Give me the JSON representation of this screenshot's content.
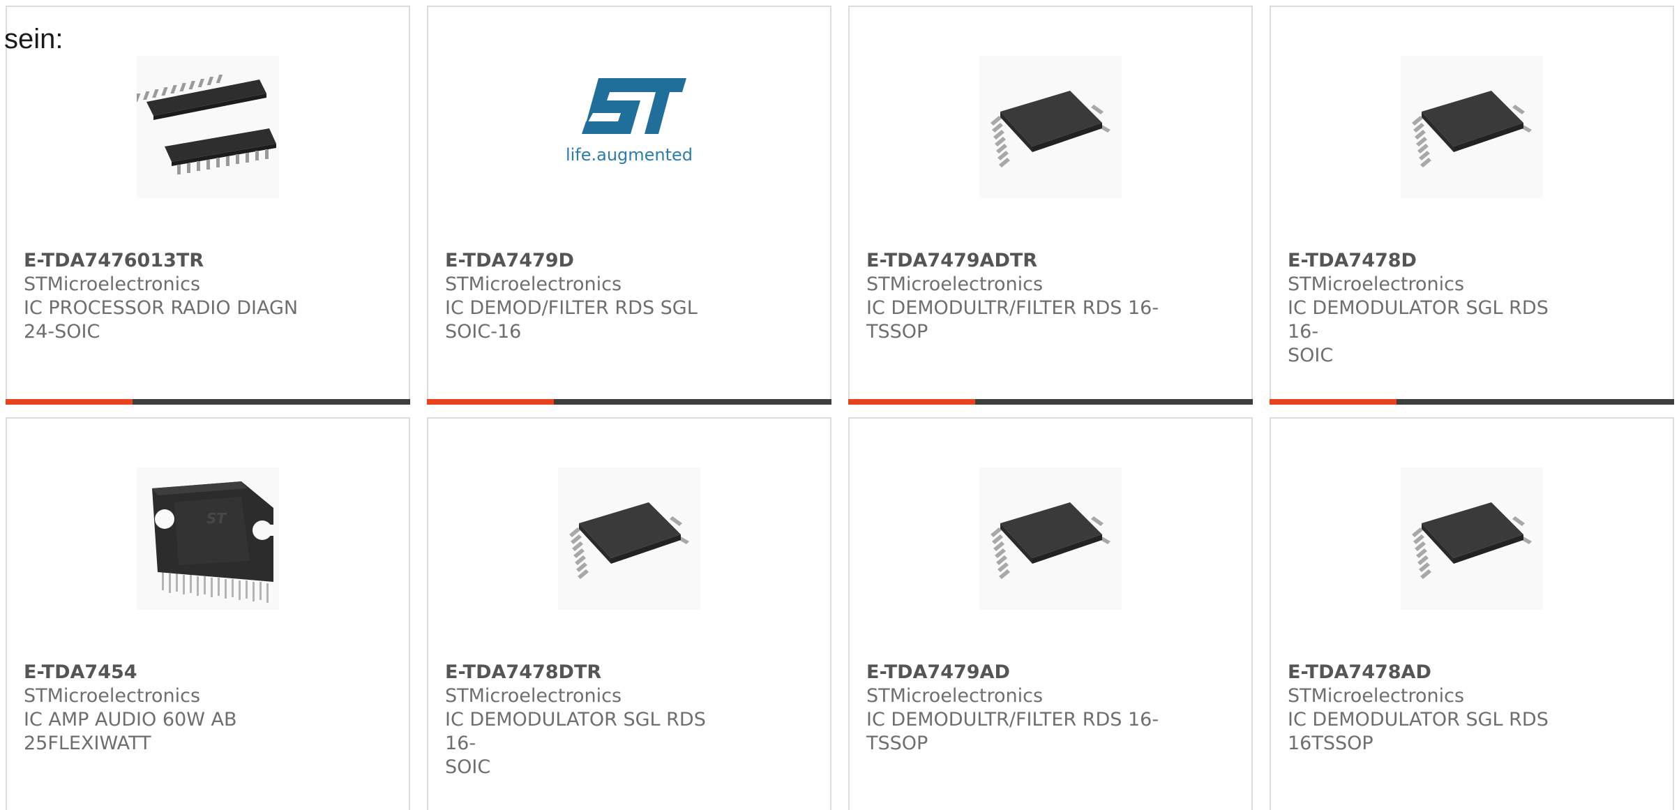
{
  "intro_text": "sein:",
  "colors": {
    "accent_orange": "#e8431b",
    "accent_dark": "#3e3e3e",
    "text": "#6e6e6e",
    "border": "#dcdcdc"
  },
  "products": [
    {
      "part_number": "E-TDA7476013TR",
      "manufacturer": "STMicroelectronics",
      "description_line1": "IC PROCESSOR RADIO DIAGN",
      "description_line2": "24-SOIC",
      "image": "soic-24-package-image"
    },
    {
      "part_number": "E-TDA7479D",
      "manufacturer": "STMicroelectronics",
      "description_line1": "IC DEMOD/FILTER RDS SGL",
      "description_line2": "SOIC-16",
      "image": "st-logo-image",
      "logo_tagline": "life.augmented"
    },
    {
      "part_number": "E-TDA7479ADTR",
      "manufacturer": "STMicroelectronics",
      "description_line1": "IC DEMODULTR/FILTER RDS 16-",
      "description_line2": "TSSOP",
      "image": "tssop-chip-image"
    },
    {
      "part_number": "E-TDA7478D",
      "manufacturer": "STMicroelectronics",
      "description_line1": "IC DEMODULATOR SGL RDS 16-",
      "description_line2": "SOIC",
      "image": "tssop-chip-image"
    },
    {
      "part_number": "E-TDA7454",
      "manufacturer": "STMicroelectronics",
      "description_line1": "IC AMP AUDIO 60W AB",
      "description_line2": "25FLEXIWATT",
      "image": "flexiwatt-package-image"
    },
    {
      "part_number": "E-TDA7478DTR",
      "manufacturer": "STMicroelectronics",
      "description_line1": "IC DEMODULATOR SGL RDS 16-",
      "description_line2": "SOIC",
      "image": "tssop-chip-image"
    },
    {
      "part_number": "E-TDA7479AD",
      "manufacturer": "STMicroelectronics",
      "description_line1": "IC DEMODULTR/FILTER RDS 16-",
      "description_line2": "TSSOP",
      "image": "tssop-chip-image"
    },
    {
      "part_number": "E-TDA7478AD",
      "manufacturer": "STMicroelectronics",
      "description_line1": "IC DEMODULATOR SGL RDS",
      "description_line2": "16TSSOP",
      "image": "tssop-chip-image"
    }
  ]
}
